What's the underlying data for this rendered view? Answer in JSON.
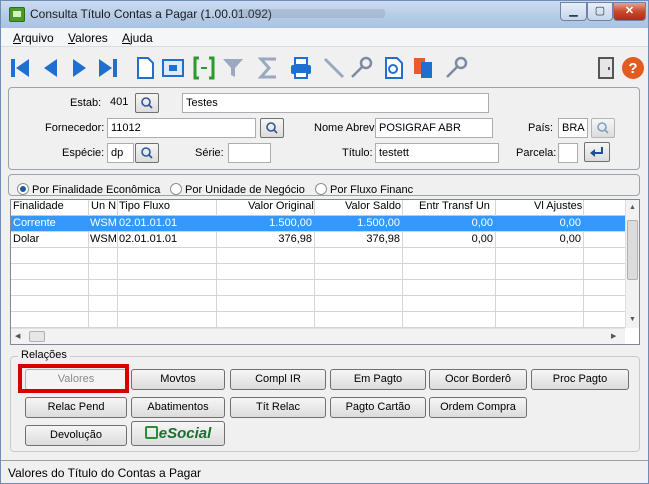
{
  "window": {
    "title": "Consulta Título Contas a Pagar (1.00.01.092)"
  },
  "menu": {
    "items": [
      "Arquivo",
      "Valores",
      "Ajuda"
    ]
  },
  "toolbar": {
    "icons": [
      "first-record-icon",
      "previous-record-icon",
      "next-record-icon",
      "last-record-icon",
      "new-document-icon",
      "screen-icon",
      "select-range-icon",
      "filter-icon",
      "sum-icon",
      "print-icon",
      "line-icon",
      "key-icon",
      "preview-icon",
      "copy-icon",
      "key2-icon",
      "exit-door-icon",
      "help-icon"
    ]
  },
  "header": {
    "estab_label": "Estab:",
    "estab_value": "401",
    "estab_desc": "Testes",
    "fornecedor_label": "Fornecedor:",
    "fornecedor_value": "11012",
    "nome_abrev_label": "Nome Abrev:",
    "nome_abrev_value": "POSIGRAF ABR",
    "pais_label": "País:",
    "pais_value": "BRA",
    "especie_label": "Espécie:",
    "especie_value": "dp",
    "serie_label": "Série:",
    "serie_value": "",
    "titulo_label": "Título:",
    "titulo_value": "testett",
    "parcela_label": "Parcela:",
    "parcela_value": ""
  },
  "view_options": {
    "options": [
      "Por Finalidade Econômica",
      "Por Unidade de Negócio",
      "Por Fluxo Financ"
    ],
    "selected": 0
  },
  "table": {
    "columns": [
      "Finalidade",
      "Un N",
      "Tipo Fluxo",
      "Valor Original",
      "Valor Saldo",
      "Entr Transf Un",
      "Vl Ajustes"
    ],
    "rows": [
      {
        "finalidade": "Corrente",
        "un": "WSM",
        "tipo_fluxo": "02.01.01.01",
        "valor_original": "1.500,00",
        "valor_saldo": "1.500,00",
        "entr_transf": "0,00",
        "vl_ajustes": "0,00",
        "selected": true
      },
      {
        "finalidade": "Dolar",
        "un": "WSM",
        "tipo_fluxo": "02.01.01.01",
        "valor_original": "376,98",
        "valor_saldo": "376,98",
        "entr_transf": "0,00",
        "vl_ajustes": "0,00",
        "selected": false
      }
    ]
  },
  "relacoes": {
    "title": "Relações",
    "buttons": [
      "Valores",
      "Movtos",
      "Compl IR",
      "Em Pagto",
      "Ocor Borderô",
      "Proc Pagto",
      "Relac Pend",
      "Abatimentos",
      "Tít Relac",
      "Pagto Cartão",
      "Ordem Compra",
      "Devolução",
      "eSocial"
    ]
  },
  "status": {
    "text": "Valores do Título do Contas a Pagar"
  },
  "colors": {
    "selection": "#3399ff",
    "highlight": "#d60000",
    "toolbar_blue": "#1f6fd1"
  }
}
